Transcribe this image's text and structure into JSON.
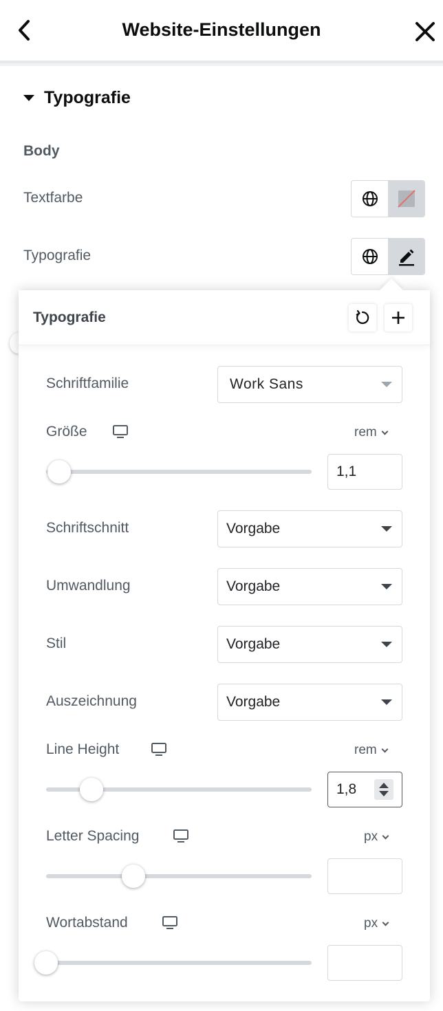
{
  "header": {
    "title": "Website-Einstellungen"
  },
  "section": {
    "title": "Typografie"
  },
  "body_group": {
    "title": "Body",
    "rows": [
      {
        "label": "Textfarbe"
      },
      {
        "label": "Typografie"
      }
    ]
  },
  "popover": {
    "title": "Typografie",
    "font_family": {
      "label": "Schriftfamilie",
      "value": "Work Sans"
    },
    "size": {
      "label": "Größe",
      "unit": "rem",
      "value": "1,1",
      "slider": 0.05
    },
    "weight": {
      "label": "Schriftschnitt",
      "value": "Vorgabe"
    },
    "transform": {
      "label": "Umwandlung",
      "value": "Vorgabe"
    },
    "style": {
      "label": "Stil",
      "value": "Vorgabe"
    },
    "decoration": {
      "label": "Auszeichnung",
      "value": "Vorgabe"
    },
    "line_height": {
      "label": "Line Height",
      "unit": "rem",
      "value": "1,8",
      "slider": 0.17
    },
    "letter_spacing": {
      "label": "Letter Spacing",
      "unit": "px",
      "value": "",
      "slider": 0.33
    },
    "word_spacing": {
      "label": "Wortabstand",
      "unit": "px",
      "value": "",
      "slider": 0.0
    }
  },
  "colors": {
    "accent": "#515962",
    "no_color_slash": "#e2726f"
  },
  "icons": [
    "chevron-left-icon",
    "close-icon",
    "caret-down-icon",
    "globe-icon",
    "no-color-swatch-icon",
    "pencil-icon",
    "reset-icon",
    "plus-icon",
    "desktop-icon"
  ]
}
